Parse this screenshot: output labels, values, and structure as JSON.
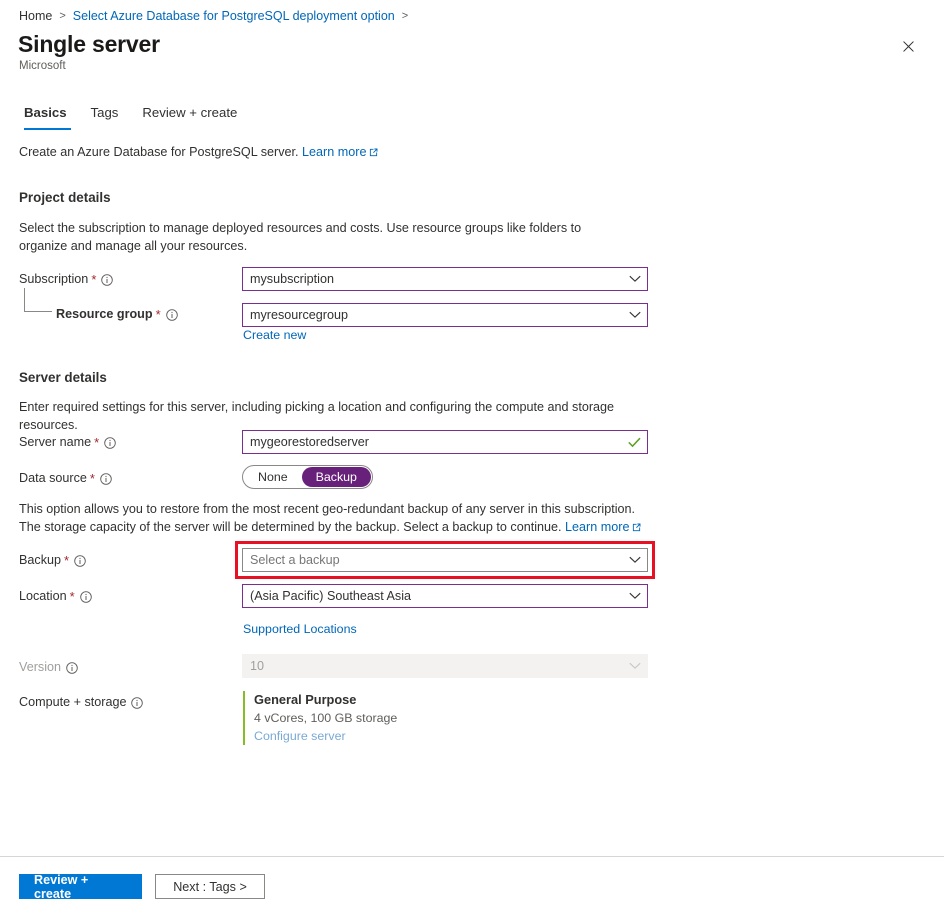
{
  "breadcrumb": {
    "home": "Home",
    "separator": ">",
    "parent": "Select Azure Database for PostgreSQL deployment option"
  },
  "header": {
    "title": "Single server",
    "publisher": "Microsoft",
    "close_icon": "close-icon"
  },
  "tabs": [
    {
      "label": "Basics",
      "active": true
    },
    {
      "label": "Tags",
      "active": false
    },
    {
      "label": "Review + create",
      "active": false
    }
  ],
  "intro": {
    "text": "Create an Azure Database for PostgreSQL server.",
    "link": "Learn more",
    "link_icon": "external-link-icon"
  },
  "project_details": {
    "heading": "Project details",
    "description": "Select the subscription to manage deployed resources and costs. Use resource groups like folders to organize and manage all your resources.",
    "subscription": {
      "label": "Subscription",
      "required": "*",
      "info_icon": "info-icon",
      "value": "mysubscription",
      "chevron_icon": "chevron-down-icon"
    },
    "resource_group": {
      "label": "Resource group",
      "required": "*",
      "info_icon": "info-icon",
      "value": "myresourcegroup",
      "chevron_icon": "chevron-down-icon",
      "create_new": "Create new"
    }
  },
  "server_details": {
    "heading": "Server details",
    "description": "Enter required settings for this server, including picking a location and configuring the compute and storage resources.",
    "server_name": {
      "label": "Server name",
      "required": "*",
      "info_icon": "info-icon",
      "value": "mygeorestoredserver",
      "valid_icon": "green-check-icon"
    },
    "data_source": {
      "label": "Data source",
      "required": "*",
      "info_icon": "info-icon",
      "options": [
        {
          "label": "None",
          "selected": false
        },
        {
          "label": "Backup",
          "selected": true
        }
      ]
    },
    "data_source_note": {
      "text": "This option allows you to restore from the most recent geo-redundant backup of any server in this subscription. The storage capacity of the server will be determined by the backup. Select a backup to continue.",
      "link": "Learn more",
      "link_icon": "external-link-icon"
    },
    "backup": {
      "label": "Backup",
      "required": "*",
      "info_icon": "info-icon",
      "placeholder": "Select a backup",
      "chevron_icon": "chevron-down-icon",
      "highlighted": true
    },
    "location": {
      "label": "Location",
      "required": "*",
      "info_icon": "info-icon",
      "value": "(Asia Pacific) Southeast Asia",
      "chevron_icon": "chevron-down-icon",
      "supported_locations": "Supported Locations"
    },
    "version": {
      "label": "Version",
      "info_icon": "info-icon",
      "value": "10",
      "chevron_icon": "chevron-down-icon",
      "disabled": true
    },
    "compute_storage": {
      "label": "Compute + storage",
      "info_icon": "info-icon",
      "tier": "General Purpose",
      "details": "4 vCores, 100 GB storage",
      "configure_link": "Configure server"
    }
  },
  "footer": {
    "review_create": "Review + create",
    "next": "Next : Tags >"
  },
  "colors": {
    "accent_blue": "#0078d4",
    "link_blue": "#0067b8",
    "field_focus_purple": "#7a2f8f",
    "toggle_selected_purple": "#68217a",
    "highlight_red": "#e81123",
    "required_red": "#a4262c",
    "valid_green": "#5ea025",
    "compute_accent_green": "#86bc25"
  }
}
